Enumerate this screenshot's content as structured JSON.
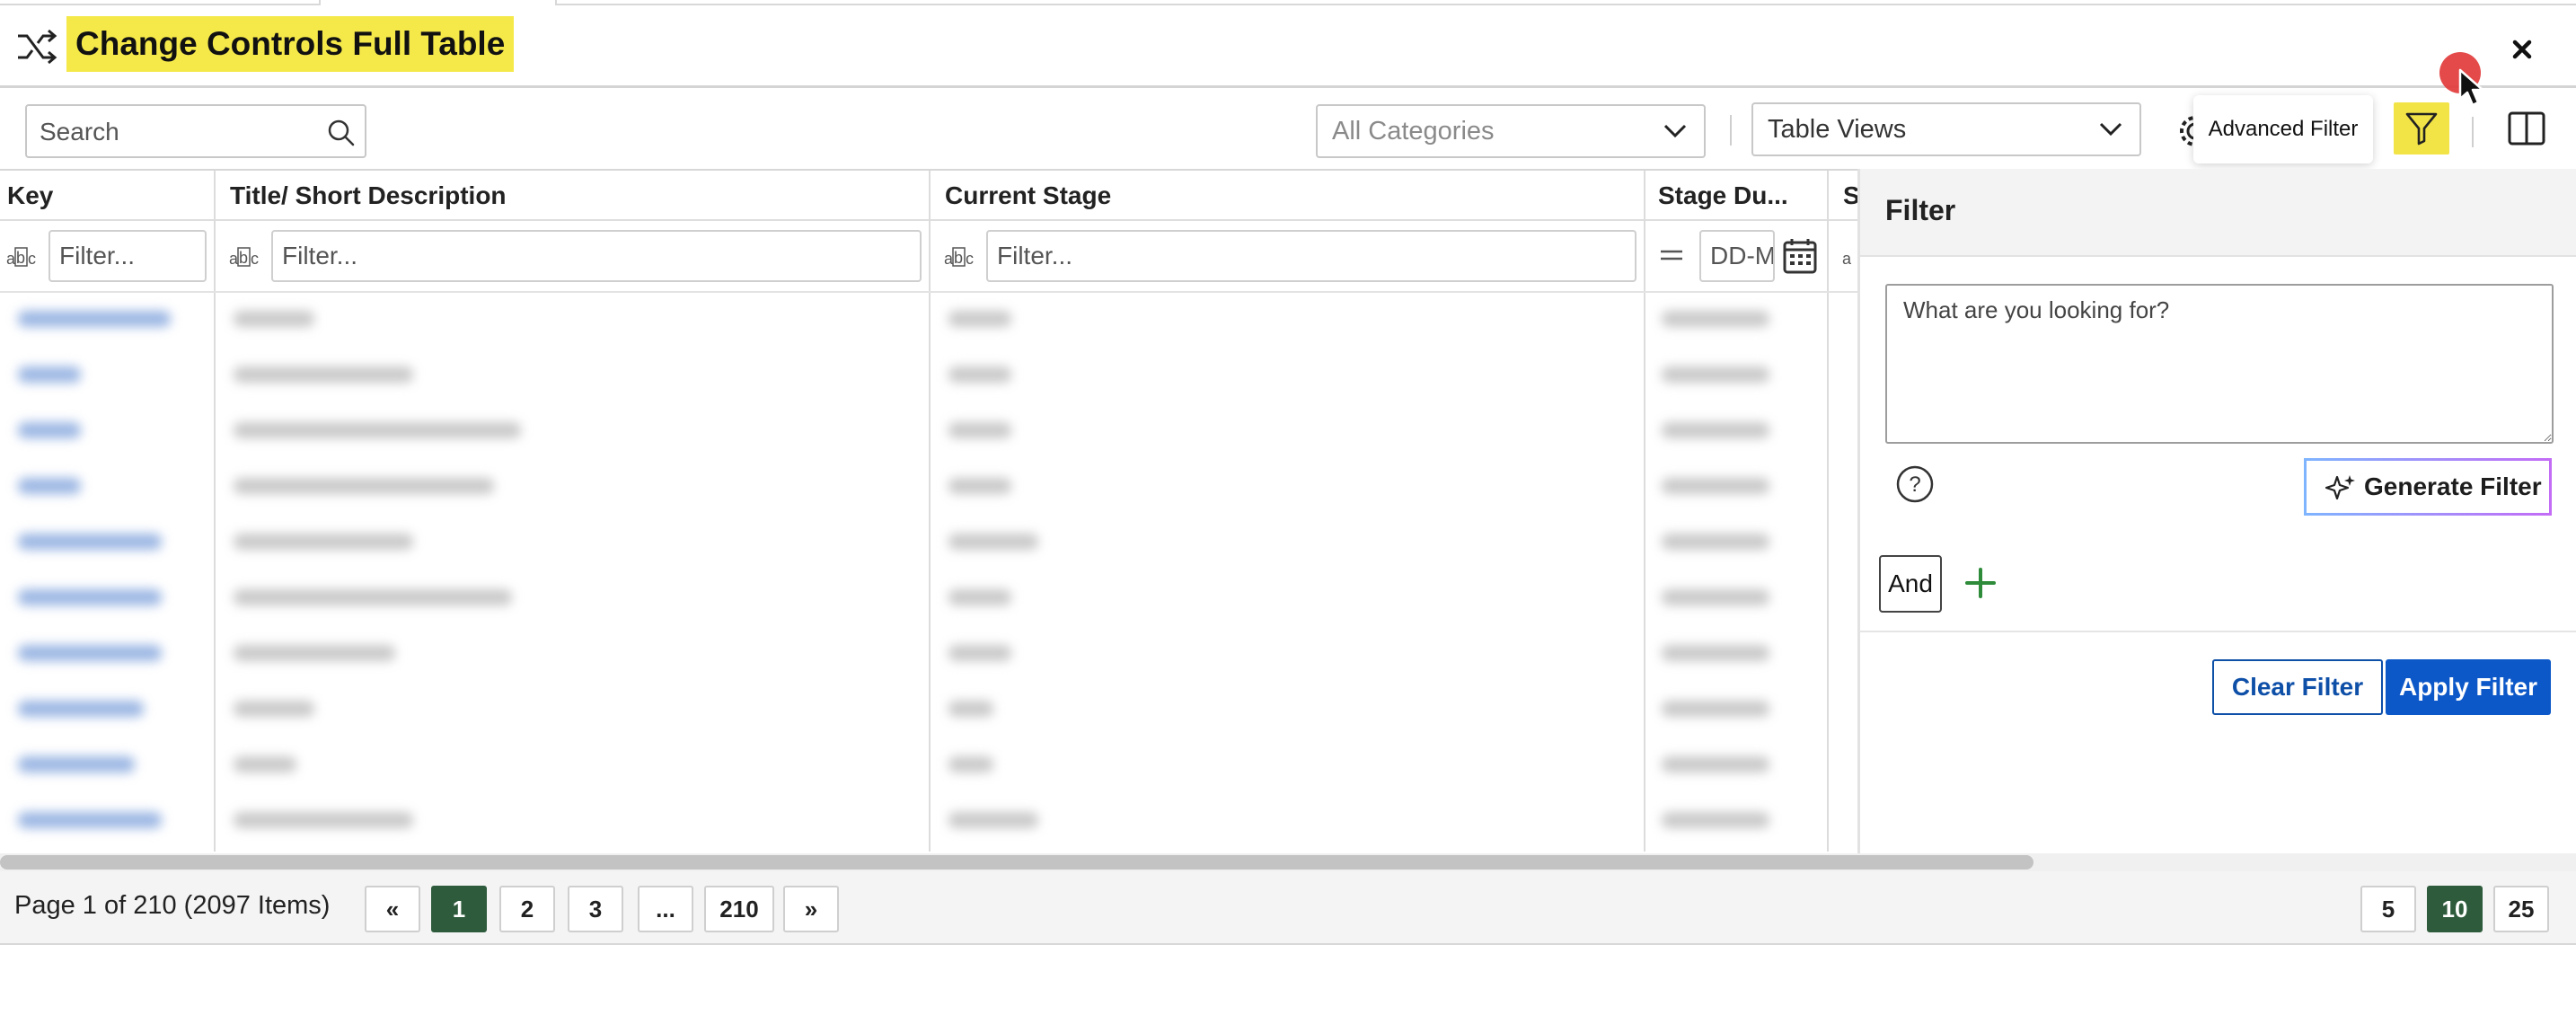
{
  "header": {
    "title": "Change Controls Full Table",
    "close_label": "×"
  },
  "toolbar": {
    "search_placeholder": "Search",
    "categories_placeholder": "All Categories",
    "views_value": "Table Views",
    "tooltip": "Advanced Filter"
  },
  "table": {
    "columns": [
      "Key",
      "Title/ Short Description",
      "Current Stage",
      "Stage Du...",
      "S"
    ],
    "filter_placeholder": "Filter...",
    "date_placeholder": "DD-MM",
    "abc_label": "a b c"
  },
  "panel": {
    "title": "Filter",
    "query_placeholder": "What are you looking for?",
    "generate_label": "Generate Filter",
    "and_label": "And",
    "clear_label": "Clear Filter",
    "apply_label": "Apply Filter"
  },
  "pagination": {
    "info": "Page 1 of 210 (2097 Items)",
    "first": "«",
    "pages": [
      "1",
      "2",
      "3",
      "...",
      "210"
    ],
    "last": "»",
    "current_page": "1",
    "sizes": [
      "5",
      "10",
      "25"
    ],
    "current_size": "10"
  },
  "colors": {
    "title_highlight": "#f5e94a",
    "primary_blue": "#0d58c9",
    "active_green": "#2e5b3c"
  }
}
